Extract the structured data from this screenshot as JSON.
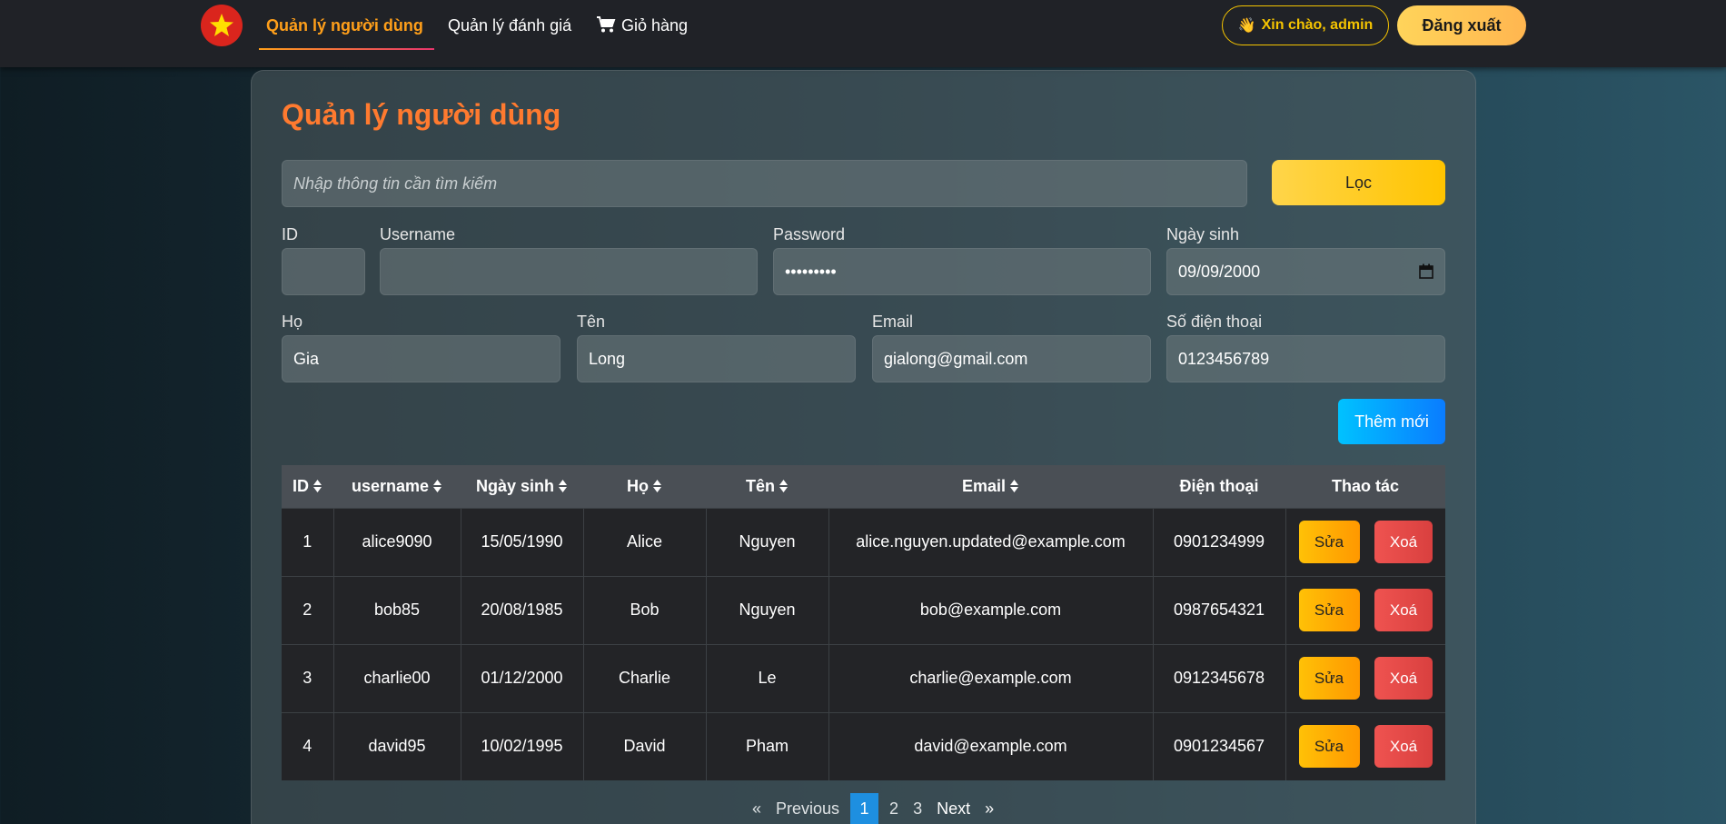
{
  "nav": {
    "links": [
      {
        "label": "Quản lý người dùng",
        "active": true
      },
      {
        "label": "Quản lý đánh giá",
        "active": false
      },
      {
        "label": "Giỏ hàng",
        "active": false
      }
    ],
    "greeting": "Xin chào, admin",
    "greeting_emoji": "👋",
    "logout": "Đăng xuất"
  },
  "page": {
    "title": "Quản lý người dùng",
    "search_placeholder": "Nhập thông tin cần tìm kiếm",
    "filter_button": "Lọc",
    "add_button": "Thêm mới"
  },
  "form": {
    "id": {
      "label": "ID",
      "value": ""
    },
    "username": {
      "label": "Username",
      "value": ""
    },
    "password": {
      "label": "Password",
      "value": "•••••••••"
    },
    "birthdate": {
      "label": "Ngày sinh",
      "value": "09/09/2000"
    },
    "last_name": {
      "label": "Họ",
      "value": "Gia"
    },
    "first_name": {
      "label": "Tên",
      "value": "Long"
    },
    "email": {
      "label": "Email",
      "value": "gialong@gmail.com"
    },
    "phone": {
      "label": "Số điện thoại",
      "value": "0123456789"
    }
  },
  "table": {
    "headers": [
      "ID",
      "username",
      "Ngày sinh",
      "Họ",
      "Tên",
      "Email",
      "Điện thoại",
      "Thao tác"
    ],
    "edit_label": "Sửa",
    "delete_label": "Xoá",
    "rows": [
      [
        "1",
        "alice9090",
        "15/05/1990",
        "Alice",
        "Nguyen",
        "alice.nguyen.updated@example.com",
        "0901234999"
      ],
      [
        "2",
        "bob85",
        "20/08/1985",
        "Bob",
        "Nguyen",
        "bob@example.com",
        "0987654321"
      ],
      [
        "3",
        "charlie00",
        "01/12/2000",
        "Charlie",
        "Le",
        "charlie@example.com",
        "0912345678"
      ],
      [
        "4",
        "david95",
        "10/02/1995",
        "David",
        "Pham",
        "david@example.com",
        "0901234567"
      ]
    ]
  },
  "pagination": {
    "prev_arrow": "«",
    "previous": "Previous",
    "pages": [
      "1",
      "2",
      "3"
    ],
    "current": "1",
    "next": "Next",
    "next_arrow": "»"
  },
  "colors": {
    "accent": "#ff7a2f",
    "nav_active": "#ff9f1a",
    "greeting": "#f5c400",
    "filter": "#ffc400",
    "add": "#0a7cff",
    "edit": "#ff9800",
    "delete": "#d9403f",
    "page_active": "#1e8fe0"
  }
}
